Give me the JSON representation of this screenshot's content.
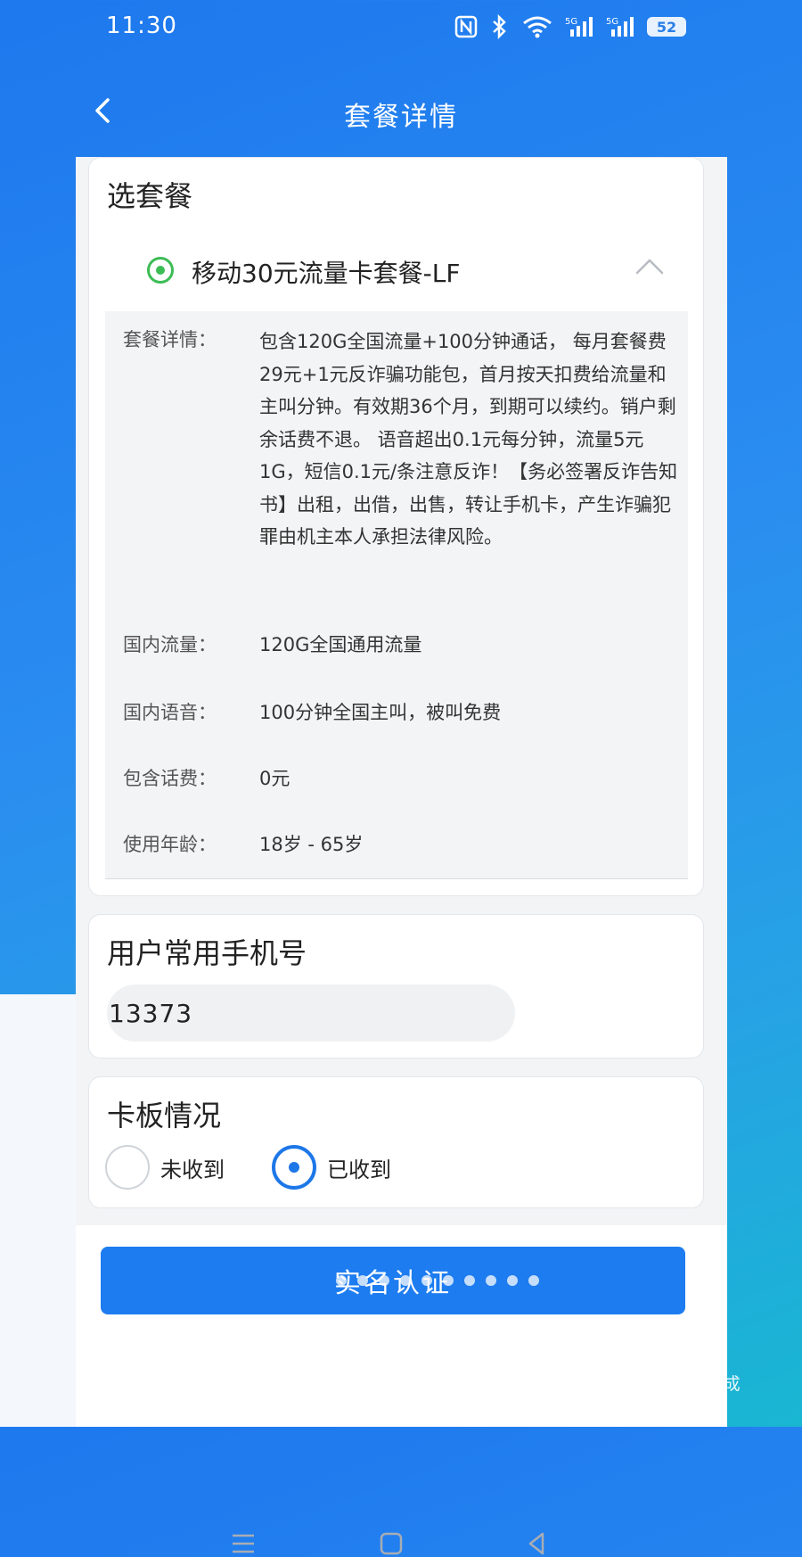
{
  "status_bar": {
    "time": "11:30",
    "battery": "52",
    "icons": [
      "nfc-icon",
      "bluetooth-icon",
      "wifi-icon",
      "signal-5g-icon",
      "signal-5g-icon",
      "battery-icon"
    ]
  },
  "nav": {
    "title": "套餐详情",
    "back_icon": "chevron-left-icon"
  },
  "plan_card": {
    "title": "选套餐",
    "selected_plan": "移动30元流量卡套餐-LF",
    "expanded": true,
    "details": [
      {
        "label": "套餐详情：",
        "value": "包含120G全国流量+100分钟通话， 每月套餐费29元+1元反诈骗功能包，首月按天扣费给流量和主叫分钟。有效期36个月，到期可以续约。销户剩余话费不退。 语音超出0.1元每分钟，流量5元1G，短信0.1元/条注意反诈！【务必签署反诈告知书】出租，出借，出售，转让手机卡，产生诈骗犯罪由机主本人承担法律风险。"
      },
      {
        "label": "国内流量：",
        "value": "120G全国通用流量"
      },
      {
        "label": "国内语音：",
        "value": "100分钟全国主叫，被叫免费"
      },
      {
        "label": "包含话费：",
        "value": "0元"
      },
      {
        "label": "使用年龄：",
        "value": "18岁 - 65岁"
      }
    ]
  },
  "phone_card": {
    "title": "用户常用手机号",
    "phone_value": "13373"
  },
  "card_status": {
    "title": "卡板情况",
    "options": [
      {
        "label": "未收到",
        "checked": false
      },
      {
        "label": "已收到",
        "checked": true
      }
    ]
  },
  "submit": {
    "label": "实名认证"
  },
  "watermark": {
    "text": "AI生成"
  },
  "colors": {
    "primary": "#1d7cf0",
    "radio_green": "#3cbc55",
    "background_gradient_start": "#1e78ee",
    "background_gradient_end": "#19b6d2"
  }
}
